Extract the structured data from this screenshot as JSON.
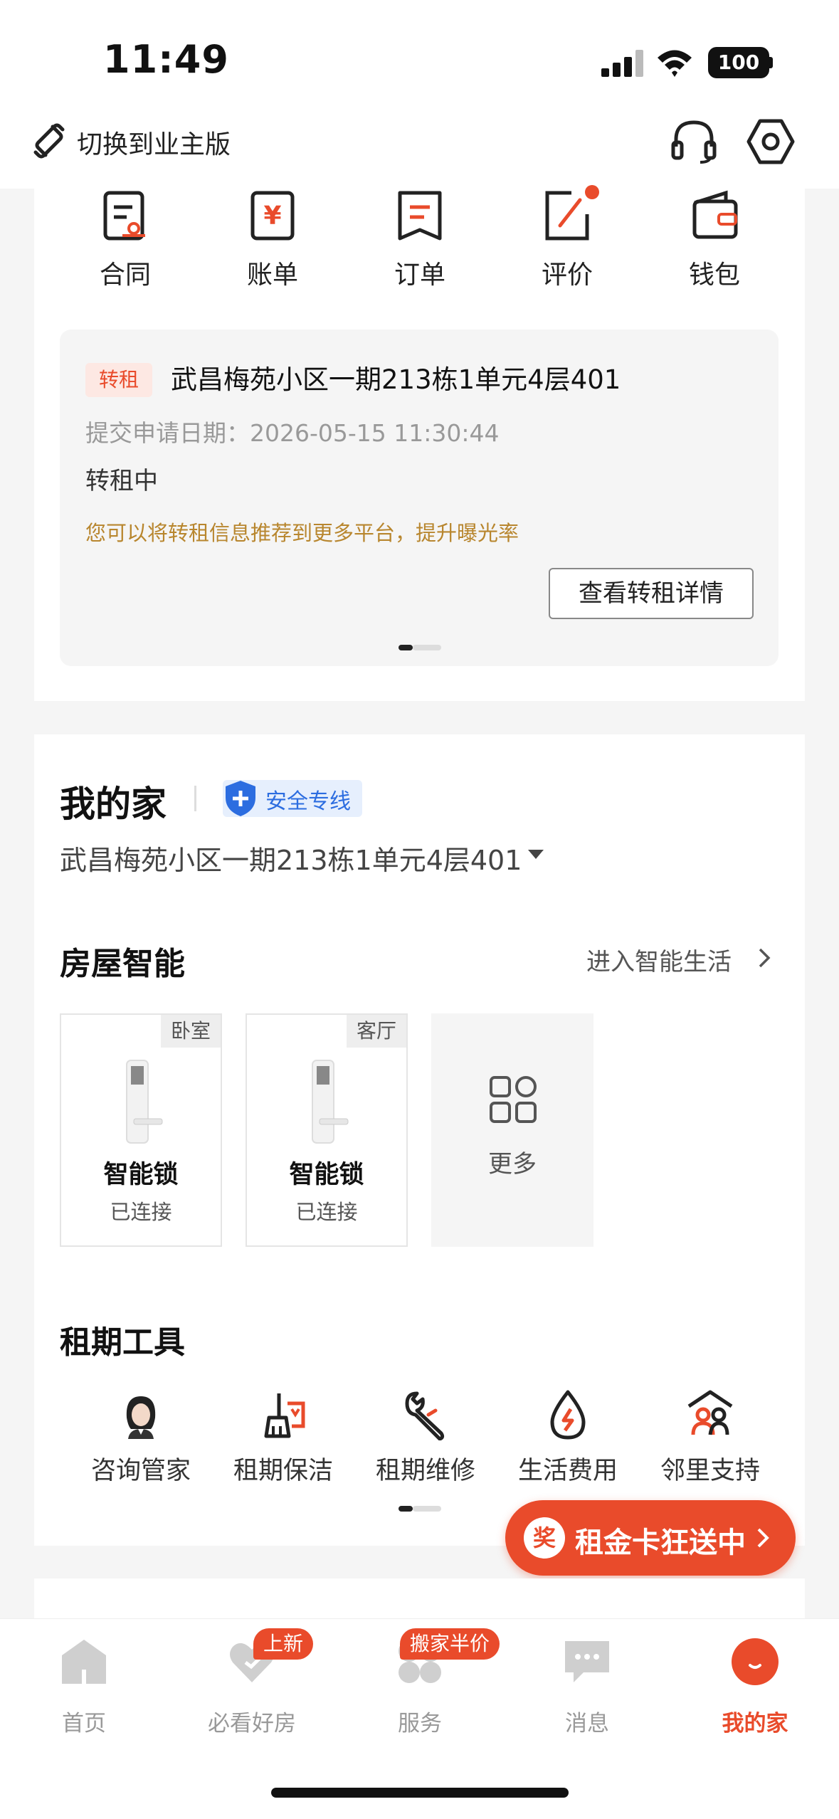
{
  "status_bar": {
    "time": "11:49",
    "battery": "100"
  },
  "header": {
    "switch_label": "切换到业主版"
  },
  "quick_actions": [
    {
      "label": "合同",
      "icon": "contract-icon"
    },
    {
      "label": "账单",
      "icon": "bill-icon"
    },
    {
      "label": "订单",
      "icon": "order-icon"
    },
    {
      "label": "评价",
      "icon": "review-icon"
    },
    {
      "label": "钱包",
      "icon": "wallet-icon"
    }
  ],
  "sublet": {
    "tag": "转租",
    "address": "武昌梅苑小区一期213栋1单元4层401",
    "date": "提交申请日期：2026-05-15 11:30:44",
    "status": "转租中",
    "tip": "您可以将转租信息推荐到更多平台，提升曝光率",
    "button": "查看转租详情"
  },
  "home": {
    "title": "我的家",
    "safety_badge": "安全专线",
    "address": "武昌梅苑小区一期213栋1单元4层401"
  },
  "smart": {
    "title": "房屋智能",
    "link": "进入智能生活",
    "devices": [
      {
        "room": "卧室",
        "name": "智能锁",
        "status": "已连接"
      },
      {
        "room": "客厅",
        "name": "智能锁",
        "status": "已连接"
      }
    ],
    "more": "更多"
  },
  "tools": {
    "title": "租期工具",
    "items": [
      {
        "label": "咨询管家",
        "icon": "butler-avatar-icon"
      },
      {
        "label": "租期保洁",
        "icon": "cleaning-icon"
      },
      {
        "label": "租期维修",
        "icon": "repair-icon"
      },
      {
        "label": "生活费用",
        "icon": "utility-icon"
      },
      {
        "label": "邻里支持",
        "icon": "neighbor-icon"
      }
    ]
  },
  "promo": {
    "badge": "奖",
    "text": "租金卡狂送中"
  },
  "tabbar": {
    "items": [
      {
        "label": "首页",
        "icon": "home-icon"
      },
      {
        "label": "必看好房",
        "icon": "heart-icon",
        "badge": "上新"
      },
      {
        "label": "服务",
        "icon": "services-icon",
        "badge": "搬家半价"
      },
      {
        "label": "消息",
        "icon": "message-icon"
      },
      {
        "label": "我的家",
        "icon": "my-home-icon",
        "active": true
      }
    ]
  },
  "colors": {
    "accent": "#e94b2b",
    "safety_blue": "#2c6de0",
    "tip_gold": "#b8862e"
  }
}
